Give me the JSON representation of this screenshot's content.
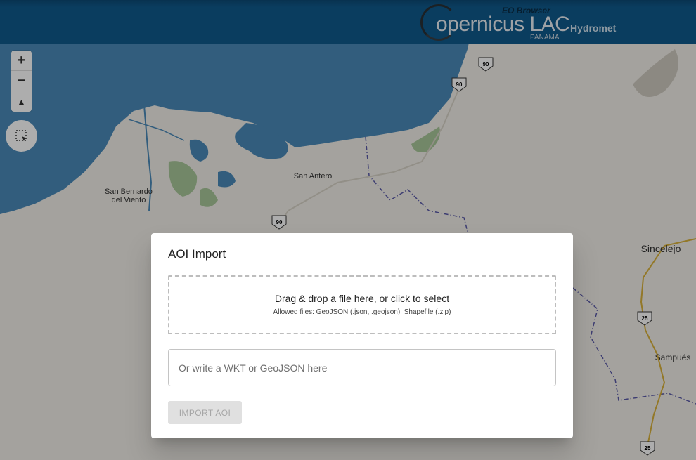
{
  "header": {
    "brand_name": "opernicus LAC",
    "brand_subtitle": "PANAMA",
    "brand_tag": "EO Browser",
    "app_name": "Hydromet",
    "bar_color": "#0f5a8c"
  },
  "map": {
    "zoom_in": "+",
    "zoom_out": "−",
    "reset_bearing": "▲",
    "places": [
      {
        "id": "san-bernardo",
        "line1": "San Bernardo",
        "line2": "del Viento"
      },
      {
        "id": "san-antero",
        "line1": "San Antero"
      },
      {
        "id": "sincelejo",
        "line1": "Sincelejo"
      },
      {
        "id": "sampues",
        "line1": "Sampués"
      }
    ],
    "route_shields": [
      "90",
      "90",
      "90",
      "25",
      "25"
    ],
    "water_color": "#4a8ab8",
    "land_color": "#f2efe9"
  },
  "dialog": {
    "title": "AOI Import",
    "dropzone_text": "Drag & drop a file here, or click to select",
    "dropzone_hint": "Allowed files: GeoJSON (.json, .geojson), Shapefile (.zip)",
    "input_placeholder": "Or write a WKT or GeoJSON here",
    "import_button": "IMPORT AOI"
  }
}
